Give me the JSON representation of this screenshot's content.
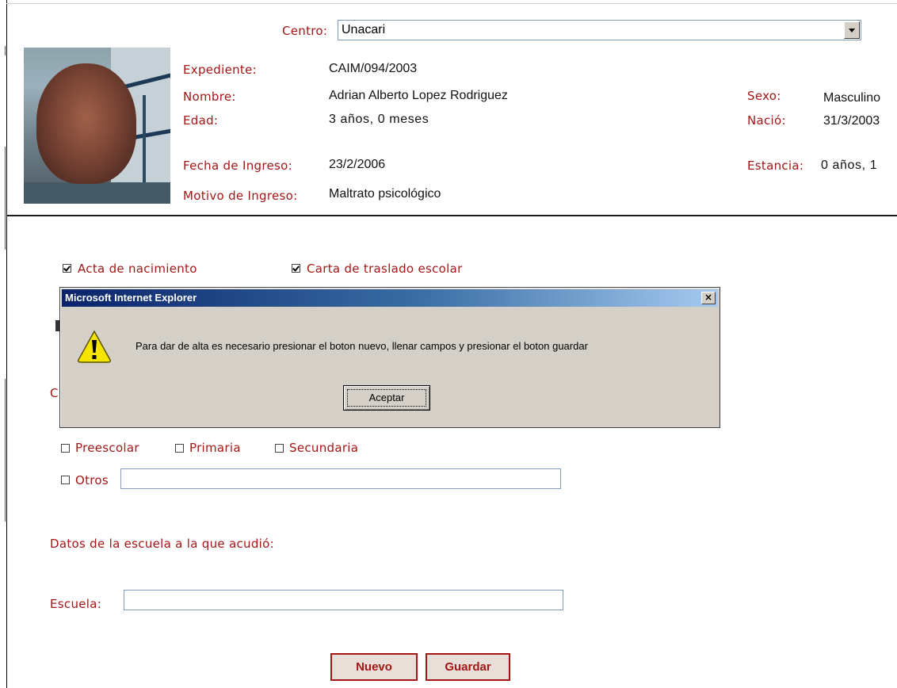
{
  "centro": {
    "label": "Centro:",
    "selected": "Unacari"
  },
  "record": {
    "expediente_label": "Expediente:",
    "expediente": "CAIM/094/2003",
    "nombre_label": "Nombre:",
    "nombre": "Adrian Alberto Lopez Rodriguez",
    "edad_label": "Edad:",
    "edad": "3 años, 0 meses",
    "sexo_label": "Sexo:",
    "sexo": "Masculino",
    "nacio_label": "Nació:",
    "nacio": "31/3/2003",
    "fecha_ingreso_label": "Fecha de Ingreso:",
    "fecha_ingreso": "23/2/2006",
    "estancia_label": "Estancia:",
    "estancia": "0 años, 1",
    "motivo_label": "Motivo de Ingreso:",
    "motivo": "Maltrato psicológico"
  },
  "documents": [
    {
      "label": "Acta de nacimiento",
      "checked": true
    },
    {
      "label": "Carta de traslado escolar",
      "checked": true
    }
  ],
  "partial": {
    "left_c": "C"
  },
  "school_levels": [
    {
      "label": "Preescolar",
      "checked": false
    },
    {
      "label": "Primaria",
      "checked": false
    },
    {
      "label": "Secundaria",
      "checked": false
    }
  ],
  "otros": {
    "label": "Otros",
    "checked": false,
    "value": ""
  },
  "school_section_title": "Datos de la escuela a la que acudió:",
  "escuela": {
    "label": "Escuela:",
    "value": ""
  },
  "buttons": {
    "nuevo": "Nuevo",
    "guardar": "Guardar"
  },
  "dialog": {
    "title": "Microsoft Internet Explorer",
    "close": "×",
    "message": "Para dar de alta es necesario presionar el boton nuevo, llenar campos y presionar el boton guardar",
    "ok_label": "Aceptar",
    "icon": "warning-icon"
  }
}
